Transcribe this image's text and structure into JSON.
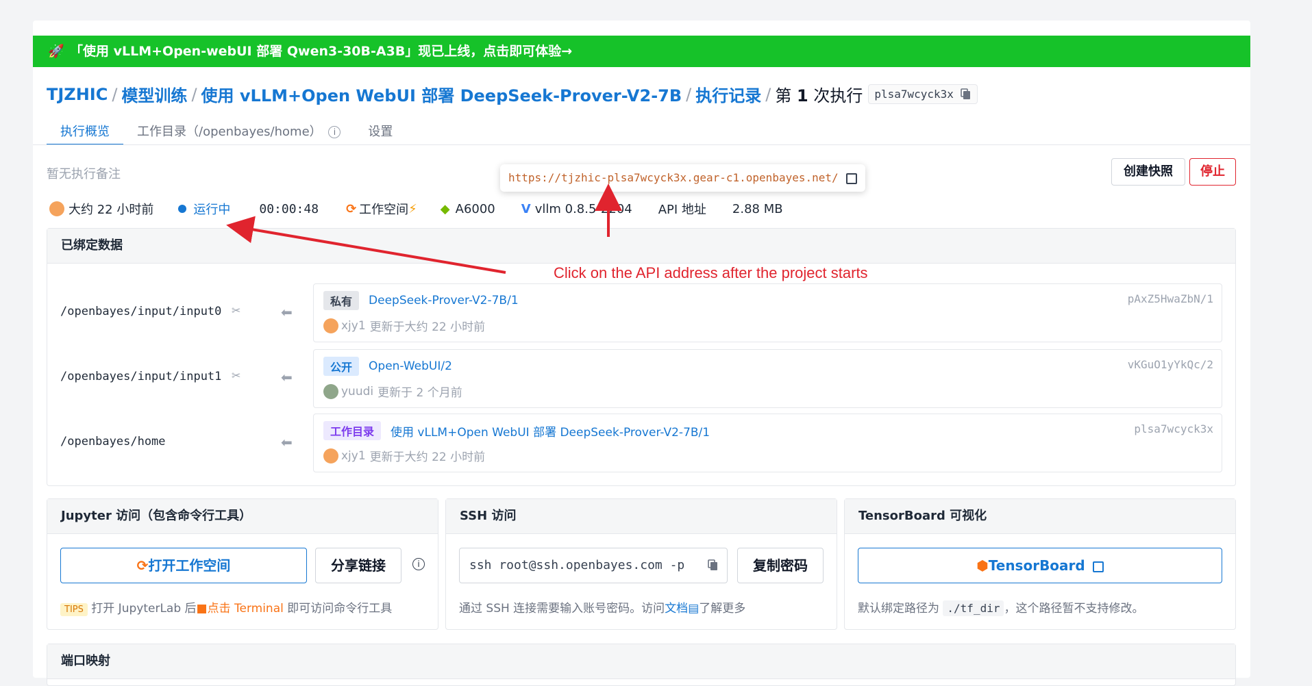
{
  "banner": {
    "icon": "rocket-icon",
    "text": "「使用 vLLM+Open-webUI 部署 Qwen3-30B-A3B」现已上线，点击即可体验→"
  },
  "breadcrumb": {
    "org": "TJZHIC",
    "section": "模型训练",
    "project": "使用 vLLM+Open WebUI 部署 DeepSeek-Prover-V2-7B",
    "records": "执行记录",
    "current_prefix": "第",
    "current_num": "1",
    "current_suffix": "次执行",
    "id": "plsa7wcyck3x"
  },
  "tabs": [
    "执行概览",
    "工作目录（/openbayes/home）",
    "设置"
  ],
  "note": "暂无执行备注",
  "actions": {
    "snapshot": "创建快照",
    "stop": "停止"
  },
  "tooltip_url": "https://tjzhic-plsa7wcyck3x.gear-c1.openbayes.net/",
  "status": {
    "created": "大约 22 小时前",
    "state": "运行中",
    "elapsed": "00:00:48",
    "workspace": "工作空间",
    "gpu": "A6000",
    "image": "vllm 0.8.5-2204",
    "api": "API 地址",
    "size": "2.88 MB"
  },
  "annotation": "Click on the API address after the project starts",
  "bound": {
    "title": "已绑定数据",
    "rows": [
      {
        "path": "/openbayes/input/input0",
        "badge": "私有",
        "name": "DeepSeek-Prover-V2-7B/1",
        "hash": "pAxZ5HwaZbN/1",
        "user": "xjy1",
        "updated": "更新于大约 22 小时前"
      },
      {
        "path": "/openbayes/input/input1",
        "badge": "公开",
        "name": "Open-WebUI/2",
        "hash": "vKGuO1yYkQc/2",
        "user": "yuudi",
        "updated": "更新于 2 个月前"
      },
      {
        "path": "/openbayes/home",
        "badge": "工作目录",
        "name": "使用 vLLM+Open WebUI 部署 DeepSeek-Prover-V2-7B/1",
        "hash": "plsa7wcyck3x",
        "user": "xjy1",
        "updated": "更新于大约 22 小时前"
      }
    ]
  },
  "jupyter": {
    "title": "Jupyter 访问（包含命令行工具）",
    "open": "打开工作空间",
    "share": "分享链接",
    "tips_badge": "TIPS",
    "tips_a": "打开 JupyterLab 后",
    "tips_link": "点击 Terminal",
    "tips_b": "即可访问命令行工具"
  },
  "ssh": {
    "title": "SSH 访问",
    "command": "ssh root@ssh.openbayes.com -p",
    "copy": "复制密码",
    "desc_a": "通过 SSH 连接需要输入账号密码。访问",
    "doc": "文档",
    "desc_b": "了解更多"
  },
  "tensorboard": {
    "title": "TensorBoard 可视化",
    "open": "TensorBoard",
    "desc_a": "默认绑定路径为",
    "path": "./tf_dir",
    "desc_b": "，这个路径暂不支持修改。"
  },
  "ports": {
    "title": "端口映射"
  },
  "colors": {
    "accent": "#1677d2",
    "banner": "#16c229",
    "stop": "#e0242e",
    "annotation": "#e0242e"
  }
}
